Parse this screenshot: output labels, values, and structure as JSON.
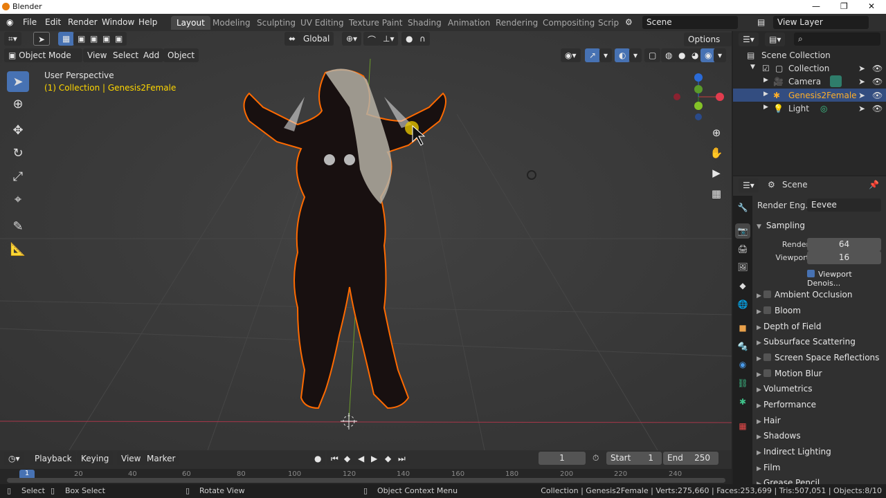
{
  "window": {
    "title": "Blender"
  },
  "menu": [
    "File",
    "Edit",
    "Render",
    "Window",
    "Help"
  ],
  "workspaces": [
    "Layout",
    "Modeling",
    "Sculpting",
    "UV Editing",
    "Texture Paint",
    "Shading",
    "Animation",
    "Rendering",
    "Compositing",
    "Scrip"
  ],
  "scene_name": "Scene",
  "view_layer": "View Layer",
  "header": {
    "mode": "Object Mode",
    "menus": [
      "View",
      "Select",
      "Add",
      "Object"
    ],
    "orientation": "Global",
    "options": "Options"
  },
  "viewport": {
    "perspective_label": "User Perspective",
    "collection_label": "(1) Collection | Genesis2Female"
  },
  "outliner": {
    "root": "Scene Collection",
    "items": [
      "Collection",
      "Camera",
      "Genesis2Female",
      "Light"
    ],
    "selected": "Genesis2Female"
  },
  "properties": {
    "context": "Scene",
    "render_engine_label": "Render Eng...",
    "render_engine_value": "Eevee",
    "sampling_title": "Sampling",
    "render_label": "Render",
    "render_value": "64",
    "viewport_label": "Viewport",
    "viewport_value": "16",
    "viewport_denoise": "Viewport Denois...",
    "panels": [
      "Ambient Occlusion",
      "Bloom",
      "Depth of Field",
      "Subsurface Scattering",
      "Screen Space Reflections",
      "Motion Blur",
      "Volumetrics",
      "Performance",
      "Hair",
      "Shadows",
      "Indirect Lighting",
      "Film",
      "Grease Pencil"
    ]
  },
  "timeline": {
    "menus": [
      "Playback",
      "Keying",
      "View",
      "Marker"
    ],
    "current_frame": "1",
    "start_label": "Start",
    "start_value": "1",
    "end_label": "End",
    "end_value": "250",
    "ticks": [
      "1",
      "20",
      "40",
      "60",
      "80",
      "100",
      "120",
      "140",
      "160",
      "180",
      "200",
      "220",
      "240"
    ]
  },
  "status": {
    "select": "Select",
    "box_select": "Box Select",
    "rotate_view": "Rotate View",
    "context_menu": "Object Context Menu",
    "stats": "Collection | Genesis2Female | Verts:275,660 | Faces:253,699 | Tris:507,051 | Objects:8/10"
  },
  "colors": {
    "accent_blue": "#4772b3",
    "selection_orange": "#ffaf29",
    "outline_orange": "#ff6a00",
    "collection_text": "#ffd700"
  }
}
